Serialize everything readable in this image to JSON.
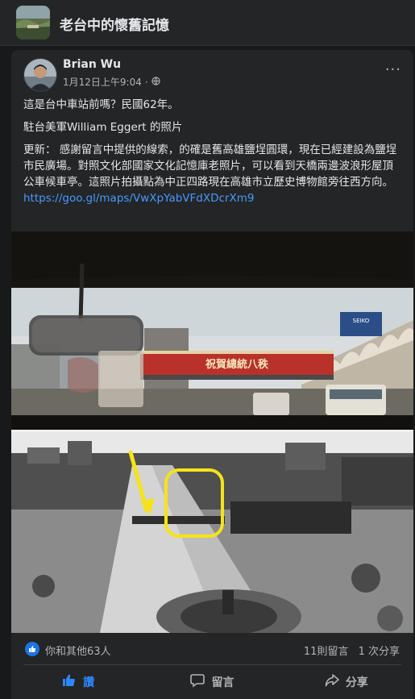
{
  "group": {
    "name": "老台中的懷舊記憶",
    "thumb_icon": "group-cover-thumbnail"
  },
  "post": {
    "author": "Brian Wu",
    "timestamp": "1月12日上午9:04",
    "separator": "·",
    "privacy_icon": "globe-icon",
    "more_label": "···",
    "paragraph1": "這是台中車站前嗎？民國62年。",
    "paragraph2": "駐台美軍William Eggert 的照片",
    "paragraph3": "更新： 感謝留言中提供的線索，的確是舊高雄鹽埕圓環，現在已經建設為鹽埕市民廣場。對照文化部國家文化記憶庫老照片，可以看到天橋兩邊波浪形屋頂公車候車亭。這照片拍攝點為中正四路現在高雄市立歷史博物館旁往西方向。",
    "link": "https://goo.gl/maps/VwXpYabVFdXDcrXm9"
  },
  "photo": {
    "banner_text": "祝賀總統八秩",
    "sign_text": "SEIKO"
  },
  "stats": {
    "likes": "你和其他63人",
    "comments": "11則留言",
    "shares": "1 次分享"
  },
  "actions": {
    "like": "讚",
    "comment": "留言",
    "share": "分享"
  },
  "colors": {
    "accent": "#2d88ff",
    "highlight": "#f5e31a"
  }
}
